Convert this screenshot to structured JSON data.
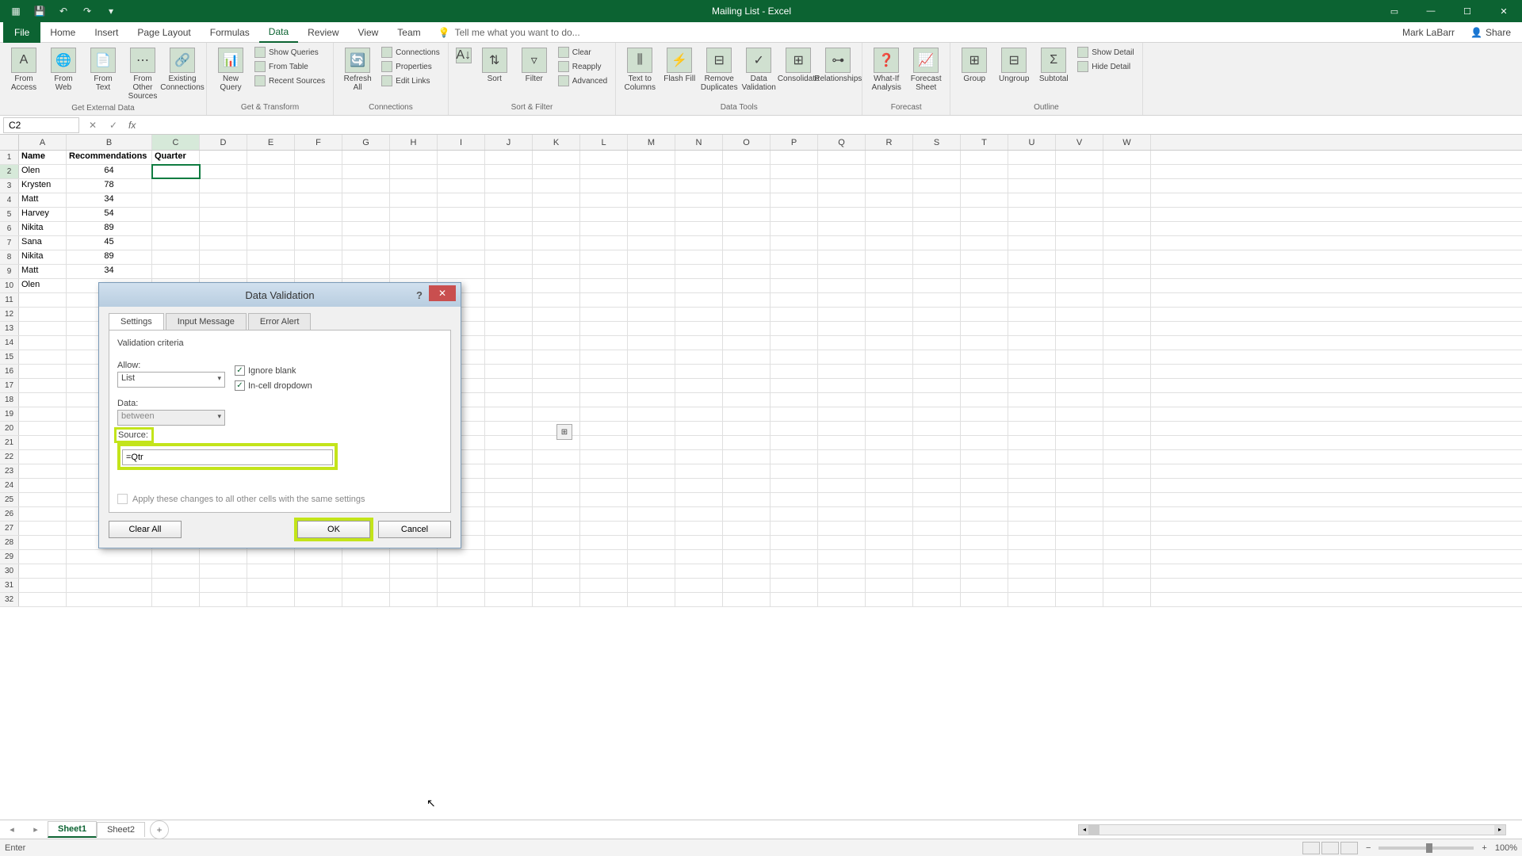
{
  "app": {
    "title": "Mailing List - Excel"
  },
  "ribbon": {
    "file": "File",
    "tabs": [
      "Home",
      "Insert",
      "Page Layout",
      "Formulas",
      "Data",
      "Review",
      "View",
      "Team"
    ],
    "active_tab": "Data",
    "tellme": "Tell me what you want to do...",
    "user": "Mark LaBarr",
    "share": "Share"
  },
  "ribbon_groups": {
    "ext": {
      "label": "Get External Data",
      "btns": [
        "From Access",
        "From Web",
        "From Text",
        "From Other Sources",
        "Existing Connections"
      ]
    },
    "transform": {
      "label": "Get & Transform",
      "big": "New Query",
      "items": [
        "Show Queries",
        "From Table",
        "Recent Sources"
      ]
    },
    "conn": {
      "label": "Connections",
      "big": "Refresh All",
      "items": [
        "Connections",
        "Properties",
        "Edit Links"
      ]
    },
    "sort": {
      "label": "Sort & Filter",
      "sort": "Sort",
      "filter": "Filter",
      "items": [
        "Clear",
        "Reapply",
        "Advanced"
      ]
    },
    "tools": {
      "label": "Data Tools",
      "btns": [
        "Text to Columns",
        "Flash Fill",
        "Remove Duplicates",
        "Data Validation",
        "Consolidate",
        "Relationships"
      ]
    },
    "forecast": {
      "label": "Forecast",
      "btns": [
        "What-If Analysis",
        "Forecast Sheet"
      ]
    },
    "outline": {
      "label": "Outline",
      "btns": [
        "Group",
        "Ungroup",
        "Subtotal"
      ],
      "items": [
        "Show Detail",
        "Hide Detail"
      ]
    }
  },
  "name_box": "C2",
  "columns": [
    "A",
    "B",
    "C",
    "D",
    "E",
    "F",
    "G",
    "H",
    "I",
    "J",
    "K",
    "L",
    "M",
    "N",
    "O",
    "P",
    "Q",
    "R",
    "S",
    "T",
    "U",
    "V",
    "W"
  ],
  "headers": {
    "A": "Name",
    "B": "Recommendations",
    "C": "Quarter"
  },
  "rows": [
    {
      "A": "Olen",
      "B": "64"
    },
    {
      "A": "Krysten",
      "B": "78"
    },
    {
      "A": "Matt",
      "B": "34"
    },
    {
      "A": "Harvey",
      "B": "54"
    },
    {
      "A": "Nikita",
      "B": "89"
    },
    {
      "A": "Sana",
      "B": "45"
    },
    {
      "A": "Nikita",
      "B": "89"
    },
    {
      "A": "Matt",
      "B": "34"
    },
    {
      "A": "Olen",
      "B": ""
    }
  ],
  "selected_cell": "C2",
  "sheets": {
    "tabs": [
      "Sheet1",
      "Sheet2"
    ],
    "active": "Sheet1"
  },
  "status": {
    "mode": "Enter",
    "zoom": "100%"
  },
  "dialog": {
    "title": "Data Validation",
    "tabs": [
      "Settings",
      "Input Message",
      "Error Alert"
    ],
    "active_tab": "Settings",
    "criteria_label": "Validation criteria",
    "allow_label": "Allow:",
    "allow_value": "List",
    "data_label": "Data:",
    "data_value": "between",
    "ignore_blank": "Ignore blank",
    "incell_dropdown": "In-cell dropdown",
    "source_label": "Source:",
    "source_value": "=Qtr",
    "apply_label": "Apply these changes to all other cells with the same settings",
    "clear": "Clear All",
    "ok": "OK",
    "cancel": "Cancel"
  }
}
